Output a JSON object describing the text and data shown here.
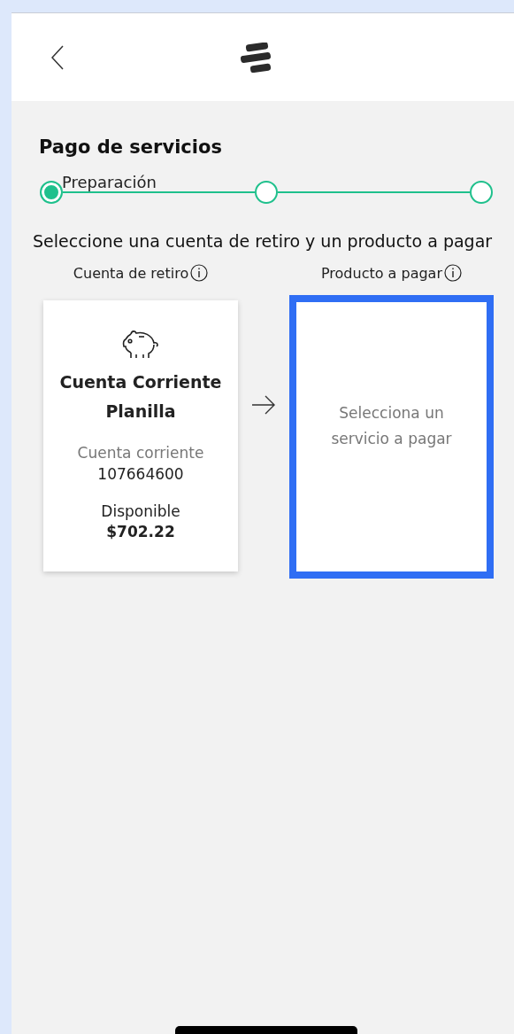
{
  "title": "Pago de servicios",
  "steps": [
    {
      "label": "Preparación",
      "selected": true
    },
    {
      "selected": false
    },
    {
      "selected": false
    }
  ],
  "instruction": "Seleccione una cuenta de retiro y un producto a pagar",
  "columns": [
    {
      "label": "Cuenta de retiro"
    },
    {
      "label": "Producto a pagar"
    }
  ],
  "account": {
    "name": "Cuenta Corriente Planilla",
    "type": "Cuenta corriente",
    "number": "107664600",
    "balance_label": "Disponible",
    "balance": "$702.22"
  },
  "product": {
    "placeholder": "Selecciona un servicio a pagar",
    "selected": true
  }
}
